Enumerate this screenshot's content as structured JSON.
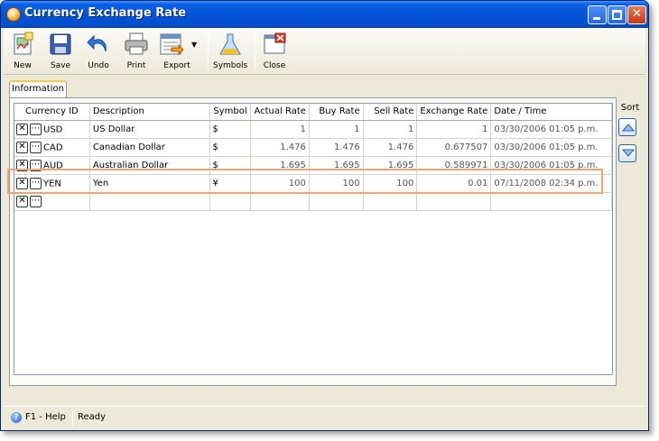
{
  "window": {
    "title": "Currency Exchange Rate"
  },
  "toolbar": {
    "items": [
      {
        "label": "New",
        "icon": "new-document-icon"
      },
      {
        "label": "Save",
        "icon": "save-icon"
      },
      {
        "label": "Undo",
        "icon": "undo-icon"
      },
      {
        "label": "Print",
        "icon": "print-icon"
      },
      {
        "label": "Export",
        "icon": "export-icon"
      },
      {
        "label": "Symbols",
        "icon": "symbols-icon"
      },
      {
        "label": "Close",
        "icon": "close-form-icon"
      }
    ]
  },
  "tabs": [
    {
      "label": "Information",
      "active": true
    }
  ],
  "grid": {
    "columns": [
      "Currency ID",
      "Description",
      "Symbol",
      "Actual Rate",
      "Buy Rate",
      "Sell Rate",
      "Exchange Rate",
      "Date / Time"
    ],
    "rows": [
      {
        "id": "USD",
        "description": "US Dollar",
        "symbol": "$",
        "actual": "1",
        "buy": "1",
        "sell": "1",
        "exchange": "1",
        "datetime": "03/30/2006 01:05 p.m."
      },
      {
        "id": "CAD",
        "description": "Canadian Dollar",
        "symbol": "$",
        "actual": "1.476",
        "buy": "1.476",
        "sell": "1.476",
        "exchange": "0.677507",
        "datetime": "03/30/2006 01:05 p.m."
      },
      {
        "id": "AUD",
        "description": "Australian Dollar",
        "symbol": "$",
        "actual": "1.695",
        "buy": "1.695",
        "sell": "1.695",
        "exchange": "0.589971",
        "datetime": "03/30/2006 01:05 p.m."
      },
      {
        "id": "YEN",
        "description": "Yen",
        "symbol": "¥",
        "actual": "100",
        "buy": "100",
        "sell": "100",
        "exchange": "0.01",
        "datetime": "07/11/2008 02:34 p.m."
      },
      {
        "id": "",
        "description": "",
        "symbol": "",
        "actual": "",
        "buy": "",
        "sell": "",
        "exchange": "",
        "datetime": ""
      }
    ],
    "highlight_color": "#f5a36a"
  },
  "sort": {
    "label": "Sort"
  },
  "statusbar": {
    "help": "F1 - Help",
    "status": "Ready"
  },
  "colors": {
    "titlebar": "#0454d8",
    "window_bg": "#ece9d8",
    "tab_accent": "#ffc83c"
  }
}
